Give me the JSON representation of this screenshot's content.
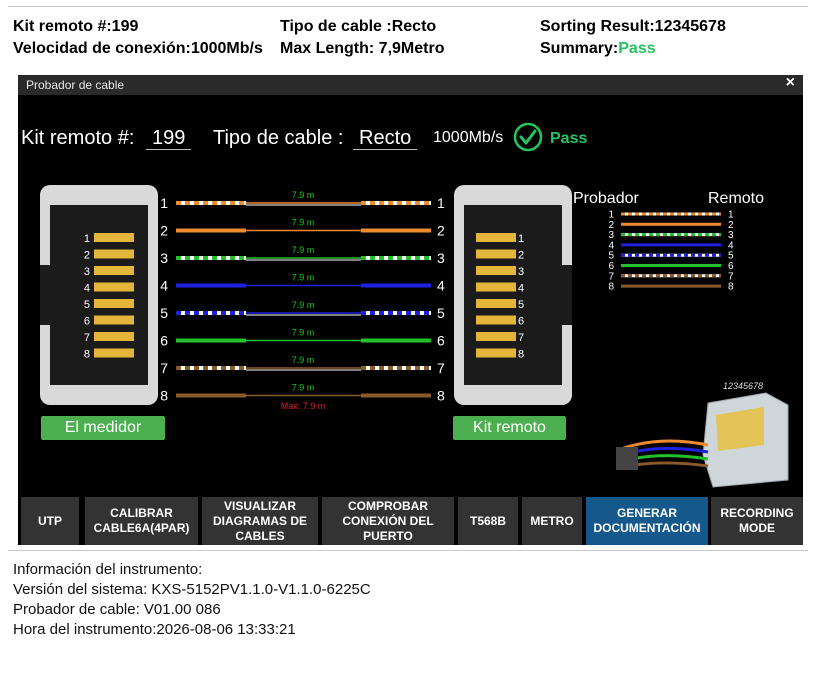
{
  "header": {
    "kit_remoto": "Kit remoto #:199",
    "velocidad": "Velocidad de conexión:1000Mb/s",
    "tipo_cable": "Tipo de cable :Recto",
    "max_length": "Max Length: 7,9Metro",
    "sorting": "Sorting Result:12345678",
    "summary_label": "Summary:",
    "summary_value": "Pass"
  },
  "dialog": {
    "title": "Probador de cable",
    "close": "×",
    "kit_label": "Kit remoto #:",
    "kit_value": "199",
    "tipo_label": "Tipo de cable :",
    "tipo_value": "Recto",
    "speed": "1000Mb/s",
    "result": "Pass",
    "medidor_button": "El medidor",
    "kit_remoto_button": "Kit remoto",
    "pins": [
      "1",
      "2",
      "3",
      "4",
      "5",
      "6",
      "7",
      "8"
    ],
    "lengths": [
      "7.9 m",
      "7.9 m",
      "7.9 m",
      "7.9 m",
      "7.9 m",
      "7.9 m",
      "7.9 m",
      "7.9 m"
    ],
    "max_label": "Max: 7.9 m",
    "legend": {
      "probador": "Probador",
      "remoto": "Remoto"
    },
    "product_code": "12345678",
    "wire_colors": [
      {
        "base": "#ffffff",
        "stripe": "#f08a30"
      },
      {
        "base": "#f08a30",
        "stripe": null
      },
      {
        "base": "#ffffff",
        "stripe": "#22c02a"
      },
      {
        "base": "#2020e0",
        "stripe": null
      },
      {
        "base": "#ffffff",
        "stripe": "#2020e0"
      },
      {
        "base": "#22c02a",
        "stripe": null
      },
      {
        "base": "#ffffff",
        "stripe": "#8b5a2b"
      },
      {
        "base": "#8b5a2b",
        "stripe": null
      }
    ]
  },
  "toolbar": {
    "buttons": [
      {
        "label": "UTP",
        "active": false
      },
      {
        "label": "CALIBRAR CABLE6A(4PAR)",
        "active": false
      },
      {
        "label": "VISUALIZAR DIAGRAMAS DE CABLES",
        "active": false
      },
      {
        "label": "COMPROBAR CONEXIÓN DEL PUERTO",
        "active": false
      },
      {
        "label": "T568B",
        "active": false
      },
      {
        "label": "METRO",
        "active": false
      },
      {
        "label": "GENERAR DOCUMENTACIÓN",
        "active": true
      },
      {
        "label": "RECORDING MODE",
        "active": false
      }
    ]
  },
  "info": {
    "heading": "Información del instrumento:",
    "system": "Versión del sistema: KXS-5152PV1.1.0-V1.1.0-6225C",
    "tester": "Probador de cable: V01.00 086",
    "time": "Hora del instrumento:2026-08-06 13:33:21"
  }
}
